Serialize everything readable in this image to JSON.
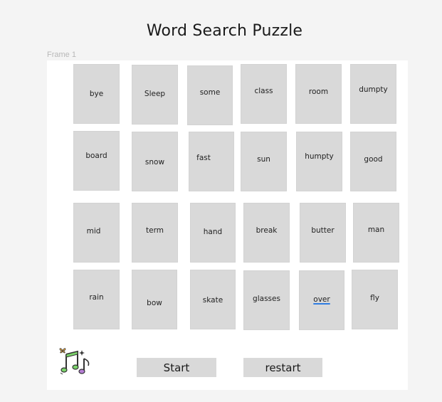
{
  "page": {
    "title": "Word Search Puzzle",
    "frame_label": "Frame 1"
  },
  "tiles": [
    {
      "word": "bye"
    },
    {
      "word": "Sleep"
    },
    {
      "word": "some"
    },
    {
      "word": "class"
    },
    {
      "word": "room"
    },
    {
      "word": "dumpty"
    },
    {
      "word": "board"
    },
    {
      "word": "snow"
    },
    {
      "word": "fast"
    },
    {
      "word": "sun"
    },
    {
      "word": "humpty"
    },
    {
      "word": "good"
    },
    {
      "word": "mid"
    },
    {
      "word": "term"
    },
    {
      "word": "hand"
    },
    {
      "word": "break"
    },
    {
      "word": "butter"
    },
    {
      "word": "man"
    },
    {
      "word": "rain"
    },
    {
      "word": "bow"
    },
    {
      "word": "skate"
    },
    {
      "word": "glasses"
    },
    {
      "word": "over",
      "underlined": true
    },
    {
      "word": "fly"
    }
  ],
  "controls": {
    "start_label": "Start",
    "restart_label": "restart"
  },
  "icons": {
    "music": "music-notes-icon"
  },
  "colors": {
    "tile": "#d9d9d9",
    "underline": "#2f7de1"
  }
}
